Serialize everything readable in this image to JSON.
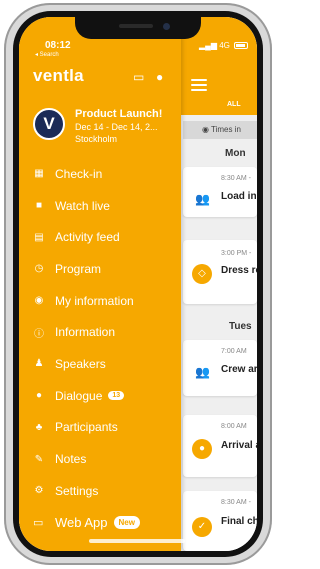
{
  "status": {
    "time": "08:12",
    "back_label": "◂ Search",
    "network": "4G"
  },
  "app": {
    "logo": "ventla"
  },
  "event": {
    "avatar_letter": "V",
    "name": "Product Launch!",
    "dates": "Dec 14 - Dec 14, 2...",
    "location": "Stockholm"
  },
  "menu": {
    "items": [
      {
        "label": "Check-in",
        "icon": "qr-code-icon"
      },
      {
        "label": "Watch live",
        "icon": "video-camera-icon"
      },
      {
        "label": "Activity feed",
        "icon": "feed-icon"
      },
      {
        "label": "Program",
        "icon": "clock-icon"
      },
      {
        "label": "My information",
        "icon": "user-circle-icon"
      },
      {
        "label": "Information",
        "icon": "info-icon"
      },
      {
        "label": "Speakers",
        "icon": "speaker-person-icon"
      },
      {
        "label": "Dialogue",
        "icon": "chat-bubbles-icon",
        "badge": "13"
      },
      {
        "label": "Participants",
        "icon": "users-icon"
      },
      {
        "label": "Notes",
        "icon": "edit-note-icon"
      },
      {
        "label": "Settings",
        "icon": "gear-icon"
      }
    ],
    "webapp": {
      "label": "Web App",
      "badge": "New",
      "icon": "monitor-icon"
    }
  },
  "main": {
    "tab_label": "ALL",
    "times_bar": "Times in",
    "days": [
      "Mon",
      "Tues"
    ],
    "cards": [
      {
        "time": "8:30 AM -",
        "title": "Load in"
      },
      {
        "time": "3:00 PM -",
        "title": "Dress re"
      },
      {
        "time": "7:00 AM",
        "title": "Crew ar"
      },
      {
        "time": "8:00 AM",
        "title": "Arrival a"
      },
      {
        "time": "8:30 AM -",
        "title": "Final ch"
      }
    ]
  },
  "colors": {
    "brand": "#f6a800",
    "avatar_bg": "#1b2b57"
  }
}
